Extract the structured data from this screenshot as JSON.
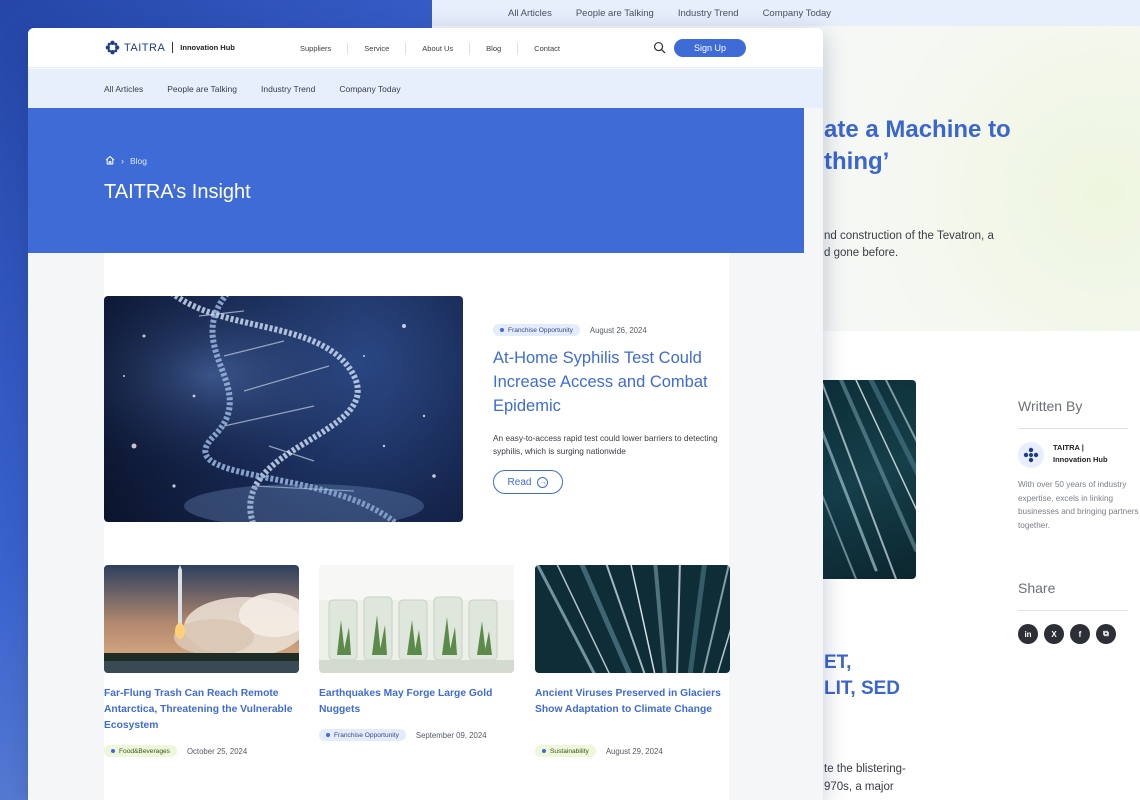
{
  "background_page": {
    "subnav": [
      "All Articles",
      "People are Talking",
      "Industry Trend",
      "Company Today"
    ],
    "title_fragment": "ate a Machine to\nthing’",
    "desc_fragment": "nd construction of the Tevatron, a\nd gone before.",
    "heading_fragment": "ET,\nLIT, SED",
    "body_fragment": "te the blistering-\n970s, a major",
    "sidebar": {
      "written_by": "Written By",
      "author_name": "TAITRA |\nInnovation Hub",
      "author_desc": "With over 50 years of industry expertise, excels in linking businesses and bringing partners together.",
      "share": "Share",
      "share_icons": [
        "linkedin-icon",
        "x-icon",
        "facebook-icon",
        "copy-link-icon"
      ],
      "share_glyphs": [
        "in",
        "X",
        "f",
        "⧉"
      ]
    }
  },
  "header": {
    "logo_text": "TAITRA",
    "logo_hub": "Innovation Hub",
    "nav": [
      "Suppliers",
      "Service",
      "About Us",
      "Blog",
      "Contact"
    ],
    "signup": "Sign Up"
  },
  "subnav": [
    "All Articles",
    "People are Talking",
    "Industry Trend",
    "Company Today"
  ],
  "hero": {
    "breadcrumb": "Blog",
    "title": "TAITRA’s Insight"
  },
  "featured": {
    "tag": "Franchise Opportunity",
    "date": "August 26, 2024",
    "title": "At-Home Syphilis Test Could Increase Access and Combat Epidemic",
    "desc": "An easy-to-access rapid test could lower barriers to detecting syphilis, which is surging nationwide",
    "read": "Read"
  },
  "cards": [
    {
      "title": "Far-Flung Trash Can Reach Remote Antarctica, Threatening the Vulnerable Ecosystem",
      "tag": "Food&Beverages",
      "date": "October 25, 2024"
    },
    {
      "title": "Earthquakes May Forge Large Gold Nuggets",
      "tag": "Franchise Opportunity",
      "date": "September 09, 2024"
    },
    {
      "title": "Ancient Viruses Preserved in Glaciers Show Adaptation to Climate Change",
      "tag": "Sustainability",
      "date": "August 29, 2024"
    }
  ],
  "colors": {
    "accent": "#3f6bd6",
    "tag_blue_bg": "#e4ebfb",
    "tag_green_bg": "#eef7d9"
  }
}
